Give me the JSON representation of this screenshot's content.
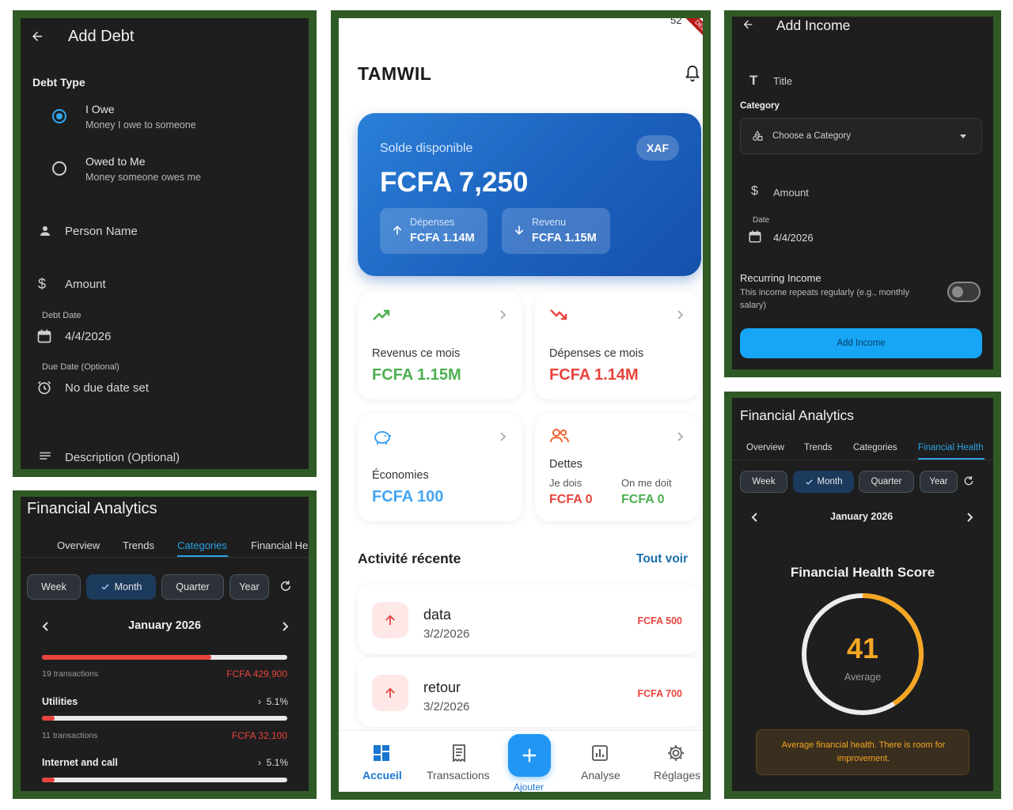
{
  "add_debt": {
    "title": "Add Debt",
    "debt_type_label": "Debt Type",
    "options": [
      {
        "title": "I Owe",
        "subtitle": "Money I owe to someone",
        "selected": true
      },
      {
        "title": "Owed to Me",
        "subtitle": "Money someone owes me",
        "selected": false
      }
    ],
    "person_placeholder": "Person Name",
    "amount_placeholder": "Amount",
    "debt_date_label": "Debt Date",
    "debt_date_value": "4/4/2026",
    "due_date_label": "Due Date (Optional)",
    "due_date_value": "No due date set",
    "description_placeholder": "Description (Optional)"
  },
  "analytics_categories": {
    "title": "Financial Analytics",
    "tabs": [
      "Overview",
      "Trends",
      "Categories",
      "Financial Hea"
    ],
    "active_tab": "Categories",
    "periods": [
      "Week",
      "Month",
      "Quarter",
      "Year"
    ],
    "selected_period": "Month",
    "month": "January 2026",
    "categories": [
      {
        "name": "",
        "transactions": "19 transactions",
        "amount": "FCFA 429,900",
        "percent": "",
        "fill": 0.69
      },
      {
        "name": "Utilities",
        "transactions": "11 transactions",
        "amount": "FCFA 32,100",
        "percent": "5.1%",
        "fill": 0.05
      },
      {
        "name": "Internet and call",
        "transactions": "",
        "amount": "",
        "percent": "5.1%",
        "fill": 0.05
      }
    ]
  },
  "home": {
    "status_time": "52",
    "debug_ribbon": "DEBUG",
    "app_name": "TAMWIL",
    "balance_label": "Solde disponible",
    "currency_badge": "XAF",
    "balance_value": "FCFA 7,250",
    "expenses_label": "Dépenses",
    "expenses_value": "FCFA 1.14M",
    "income_label": "Revenu",
    "income_value": "FCFA 1.15M",
    "cards": {
      "income_month_label": "Revenus ce mois",
      "income_month_value": "FCFA 1.15M",
      "expense_month_label": "Dépenses ce mois",
      "expense_month_value": "FCFA 1.14M",
      "savings_label": "Économies",
      "savings_value": "FCFA 100",
      "debts_label": "Dettes",
      "i_owe_label": "Je dois",
      "i_owe_value": "FCFA 0",
      "owed_me_label": "On me doit",
      "owed_me_value": "FCFA 0"
    },
    "recent_title": "Activité récente",
    "see_all": "Tout voir",
    "transactions": [
      {
        "name": "data",
        "date": "3/2/2026",
        "amount": "FCFA 500"
      },
      {
        "name": "retour",
        "date": "3/2/2026",
        "amount": "FCFA 700"
      }
    ],
    "nav": [
      "Accueil",
      "Transactions",
      "Ajouter",
      "Analyse",
      "Réglages"
    ],
    "active_nav": "Accueil",
    "colors": {
      "accent": "#1976d2",
      "income": "#4caf50",
      "expense": "#e8433c",
      "savings": "#42a5f5"
    }
  },
  "add_income": {
    "title": "Add Income",
    "title_placeholder": "Title",
    "category_label": "Category",
    "category_placeholder": "Choose a Category",
    "amount_placeholder": "Amount",
    "date_label": "Date",
    "date_value": "4/4/2026",
    "recurring_label": "Recurring Income",
    "recurring_desc_1": "This income repeats regularly (e.g., monthly",
    "recurring_desc_2": "salary)",
    "recurring_on": false,
    "button": "Add Income"
  },
  "financial_health": {
    "title": "Financial Analytics",
    "tabs": [
      "Overview",
      "Trends",
      "Categories",
      "Financial Health"
    ],
    "active_tab": "Financial Health",
    "periods": [
      "Week",
      "Month",
      "Quarter",
      "Year"
    ],
    "selected_period": "Month",
    "month": "January 2026",
    "score_title": "Financial Health Score",
    "score": 41,
    "score_max": 100,
    "score_label": "Average",
    "message_1": "Average financial health. There is room for",
    "message_2": "improvement.",
    "score_color": "#f5a623"
  }
}
